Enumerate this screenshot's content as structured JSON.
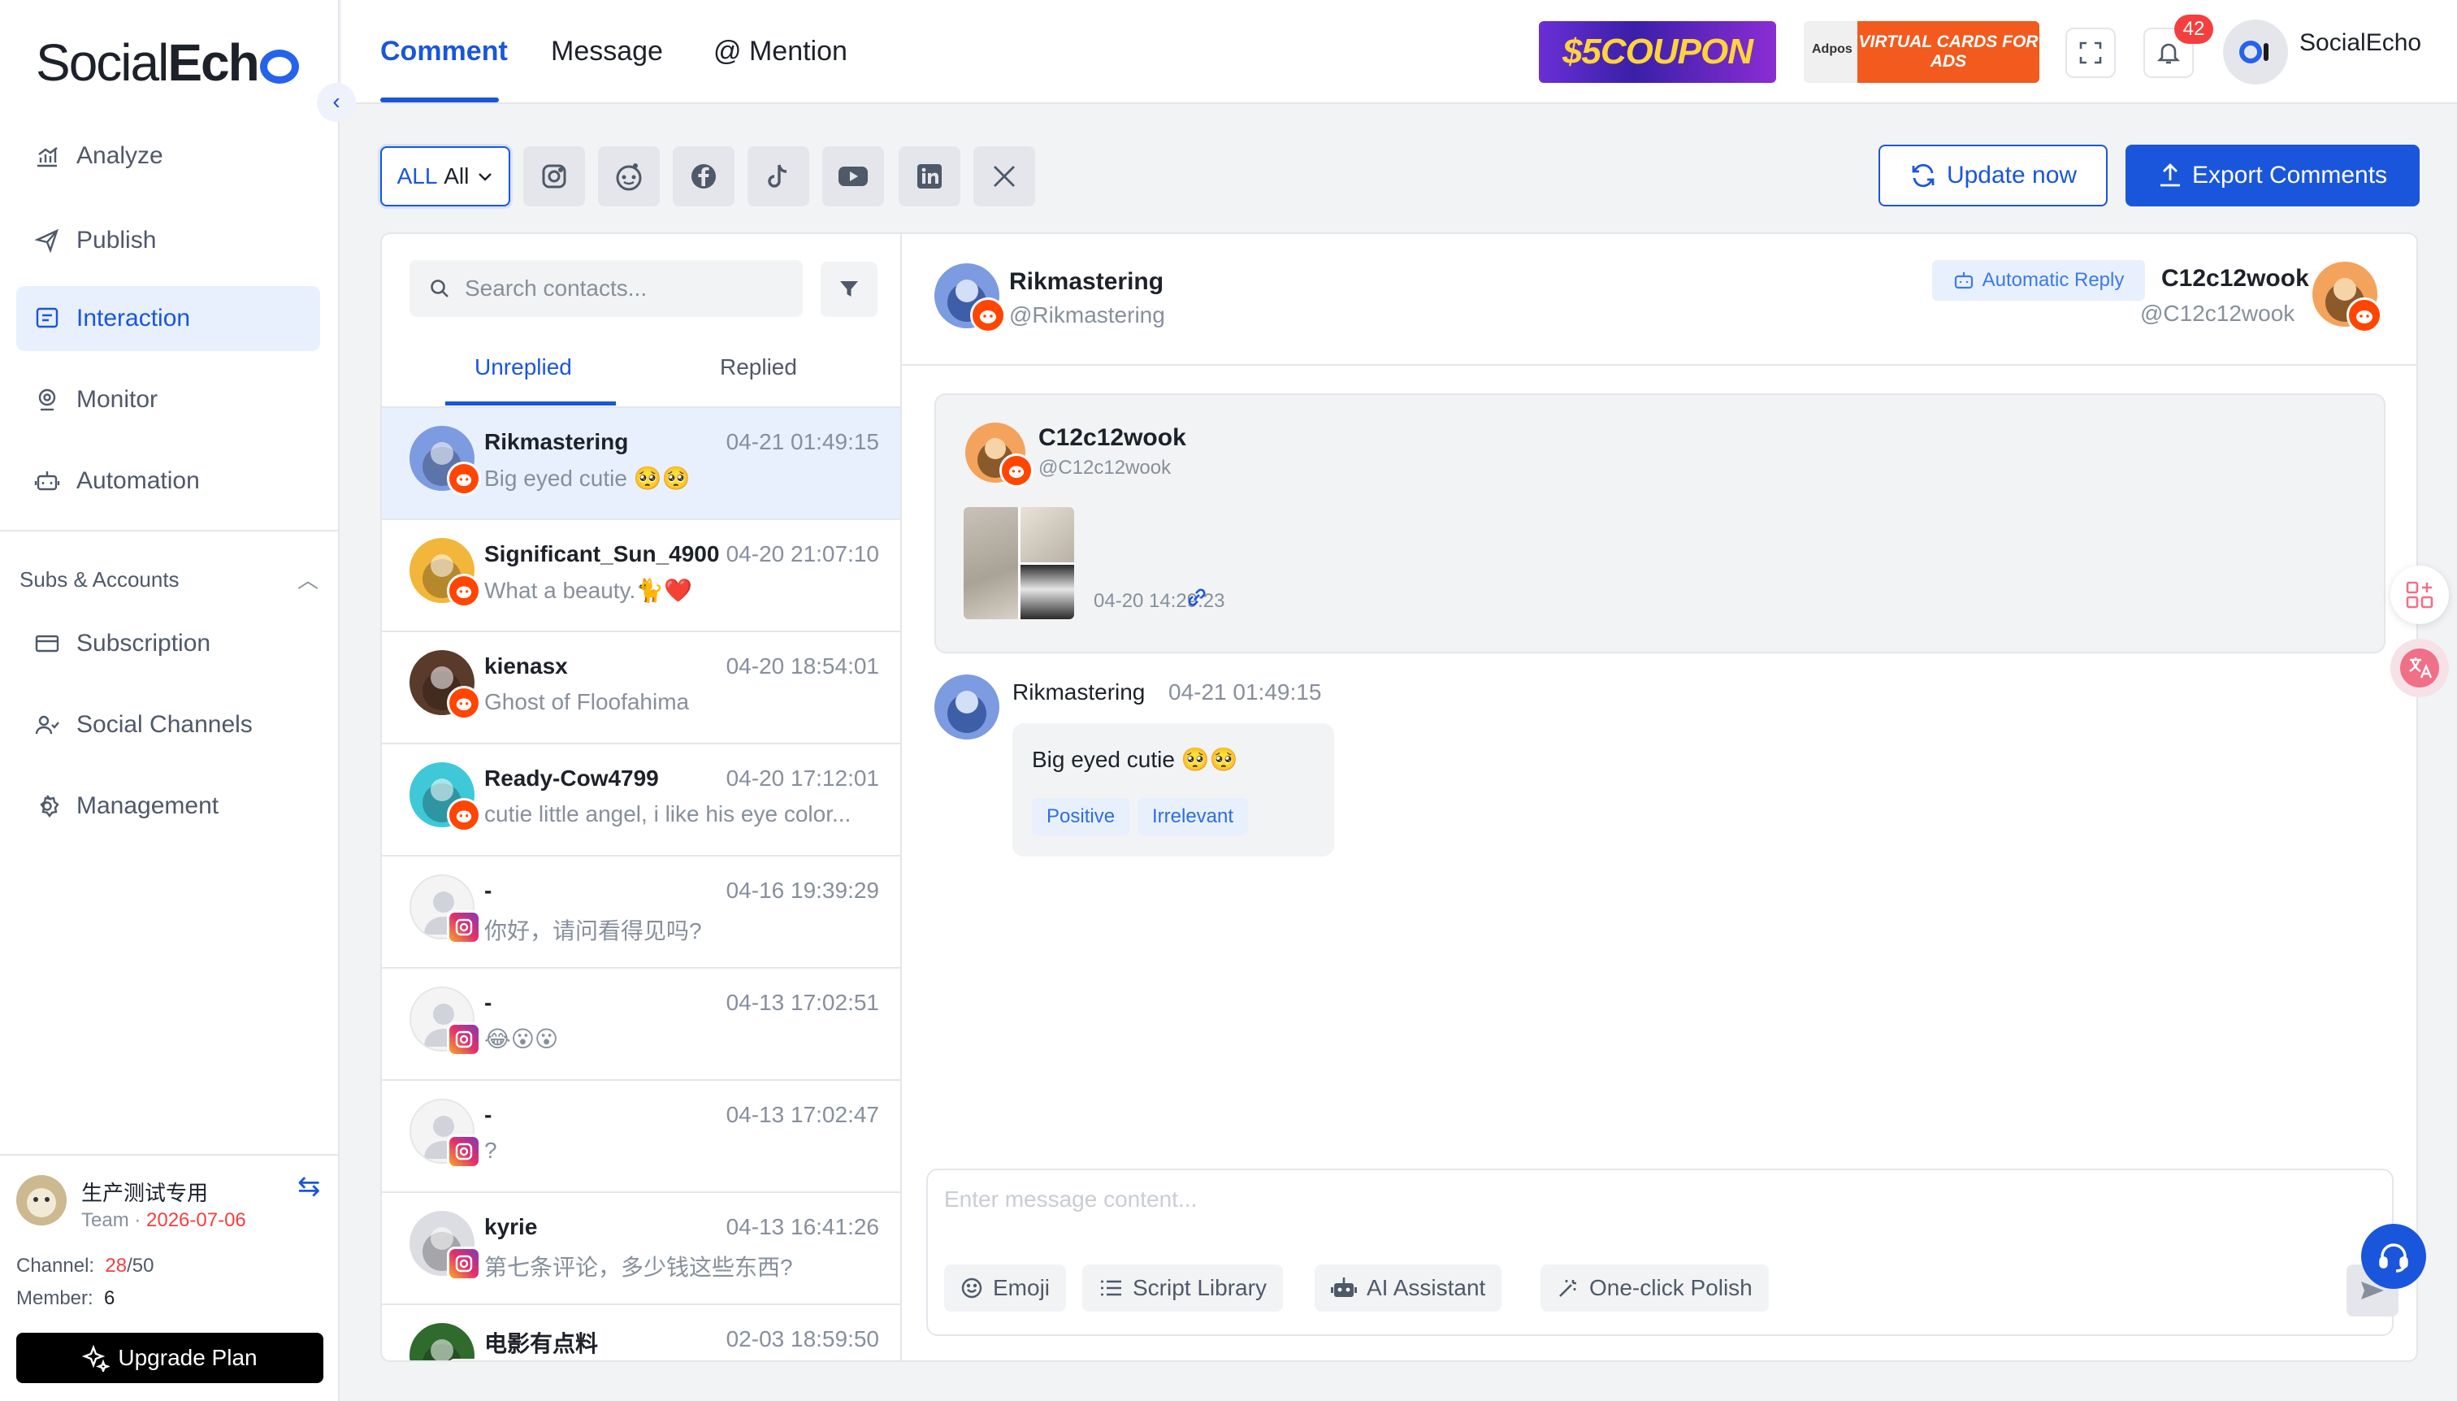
{
  "app": {
    "logo_prefix": "Social",
    "logo_bold": "Ech"
  },
  "sidebar": {
    "items": [
      {
        "label": "Analyze",
        "icon": "chart-icon"
      },
      {
        "label": "Publish",
        "icon": "send-icon"
      },
      {
        "label": "Interaction",
        "icon": "chat-icon",
        "active": true
      },
      {
        "label": "Monitor",
        "icon": "location-icon"
      },
      {
        "label": "Automation",
        "icon": "robot-icon"
      }
    ],
    "section_title": "Subs & Accounts",
    "sub_items": [
      {
        "label": "Subscription",
        "icon": "card-icon"
      },
      {
        "label": "Social Channels",
        "icon": "users-icon"
      },
      {
        "label": "Management",
        "icon": "gear-icon"
      }
    ],
    "team": {
      "name": "生产测试专用",
      "sub_prefix": "Team · ",
      "expiry": "2026-07-06",
      "channel_label": "Channel:",
      "channel_used": "28",
      "channel_total": "/50",
      "member_label": "Member:",
      "member_count": "6"
    },
    "upgrade_label": "Upgrade Plan"
  },
  "header": {
    "tabs": [
      {
        "label": "Comment",
        "active": true
      },
      {
        "label": "Message"
      },
      {
        "label": "@ Mention"
      }
    ],
    "coupon_banner": "$5COUPON",
    "adpos_label": "Adpos",
    "virtual_cards_banner": "VIRTUAL CARDS FOR ADS",
    "notification_count": "42",
    "user_name": "SocialEcho"
  },
  "filters": {
    "all_label": "ALL",
    "all_value": "All",
    "platforms": [
      "instagram-icon",
      "reddit-icon",
      "facebook-icon",
      "tiktok-icon",
      "youtube-icon",
      "linkedin-icon",
      "x-icon"
    ],
    "update_label": "Update now",
    "export_label": "Export Comments"
  },
  "contacts": {
    "search_placeholder": "Search contacts...",
    "tabs": [
      "Unreplied",
      "Replied"
    ],
    "list": [
      {
        "name": "Rikmastering",
        "time": "04-21 01:49:15",
        "msg": "Big eyed cutie 🥺🥺",
        "platform": "reddit",
        "avatar_color": "#7d9be0",
        "selected": true
      },
      {
        "name": "Significant_Sun_4900",
        "time": "04-20 21:07:10",
        "msg": "What a beauty.🐈❤️",
        "platform": "reddit",
        "avatar_color": "#f2b63a"
      },
      {
        "name": "kienasx",
        "time": "04-20 18:54:01",
        "msg": "Ghost of Floofahima",
        "platform": "reddit",
        "avatar_color": "#5a3a2a"
      },
      {
        "name": "Ready-Cow4799",
        "time": "04-20 17:12:01",
        "msg": "cutie little angel, i like his eye color...",
        "platform": "reddit",
        "avatar_color": "#3ec8d8"
      },
      {
        "name": "-",
        "time": "04-16 19:39:29",
        "msg": "你好，请问看得见吗?",
        "platform": "instagram",
        "avatar_color": "#eeeeee"
      },
      {
        "name": "-",
        "time": "04-13 17:02:51",
        "msg": "😂😮😮",
        "platform": "instagram",
        "avatar_color": "#eeeeee"
      },
      {
        "name": "-",
        "time": "04-13 17:02:47",
        "msg": "?",
        "platform": "instagram",
        "avatar_color": "#eeeeee"
      },
      {
        "name": "kyrie",
        "time": "04-13 16:41:26",
        "msg": "第七条评论，多少钱这些东西?",
        "platform": "instagram",
        "avatar_color": "#dcdde3"
      },
      {
        "name": "电影有点料",
        "time": "02-03 18:59:50",
        "msg": "",
        "platform": "instagram",
        "avatar_color": "#2f6b2c"
      }
    ]
  },
  "conversation": {
    "user_name": "Rikmastering",
    "user_handle": "@Rikmastering",
    "auto_reply_label": "Automatic Reply",
    "account_name": "C12c12wook",
    "account_handle": "@C12c12wook",
    "post": {
      "author": "C12c12wook",
      "handle": "@C12c12wook",
      "time": "04-20 14:29:23"
    },
    "message": {
      "author": "Rikmastering",
      "time": "04-21 01:49:15",
      "text": "Big eyed cutie 🥺🥺",
      "tags": [
        "Positive",
        "Irrelevant"
      ]
    },
    "compose_placeholder": "Enter message content...",
    "tools": [
      {
        "label": "Emoji",
        "icon": "smile-icon"
      },
      {
        "label": "Script Library",
        "icon": "list-icon"
      },
      {
        "label": "AI Assistant",
        "icon": "robot-icon"
      },
      {
        "label": "One-click Polish",
        "icon": "wand-icon"
      }
    ]
  },
  "colors": {
    "accent": "#1a56db",
    "reddit": "#ff4500",
    "instagram": "#e1306c",
    "danger": "#f53f3f"
  }
}
